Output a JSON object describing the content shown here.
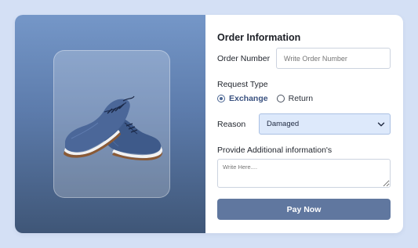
{
  "form": {
    "title": "Order Information",
    "order_number_label": "Order Number",
    "order_number_placeholder": "Write Order Number",
    "request_type_label": "Request Type",
    "request_options": [
      {
        "label": "Exchange",
        "selected": true
      },
      {
        "label": "Return",
        "selected": false
      }
    ],
    "reason_label": "Reason",
    "reason_value": "Damaged",
    "additional_label": "Provide Additional information's",
    "additional_placeholder": "Write Here....",
    "pay_label": "Pay Now"
  },
  "product": {
    "image": "blue-leather-oxford-shoes"
  },
  "colors": {
    "page_background": "#d4e0f5",
    "accent": "#60779f",
    "select_background": "#dde9fb",
    "panel_gradient_top": "#7597c8",
    "panel_gradient_bottom": "#3f5677"
  },
  "icons": {
    "reason_dropdown": "chevron-down-icon"
  }
}
